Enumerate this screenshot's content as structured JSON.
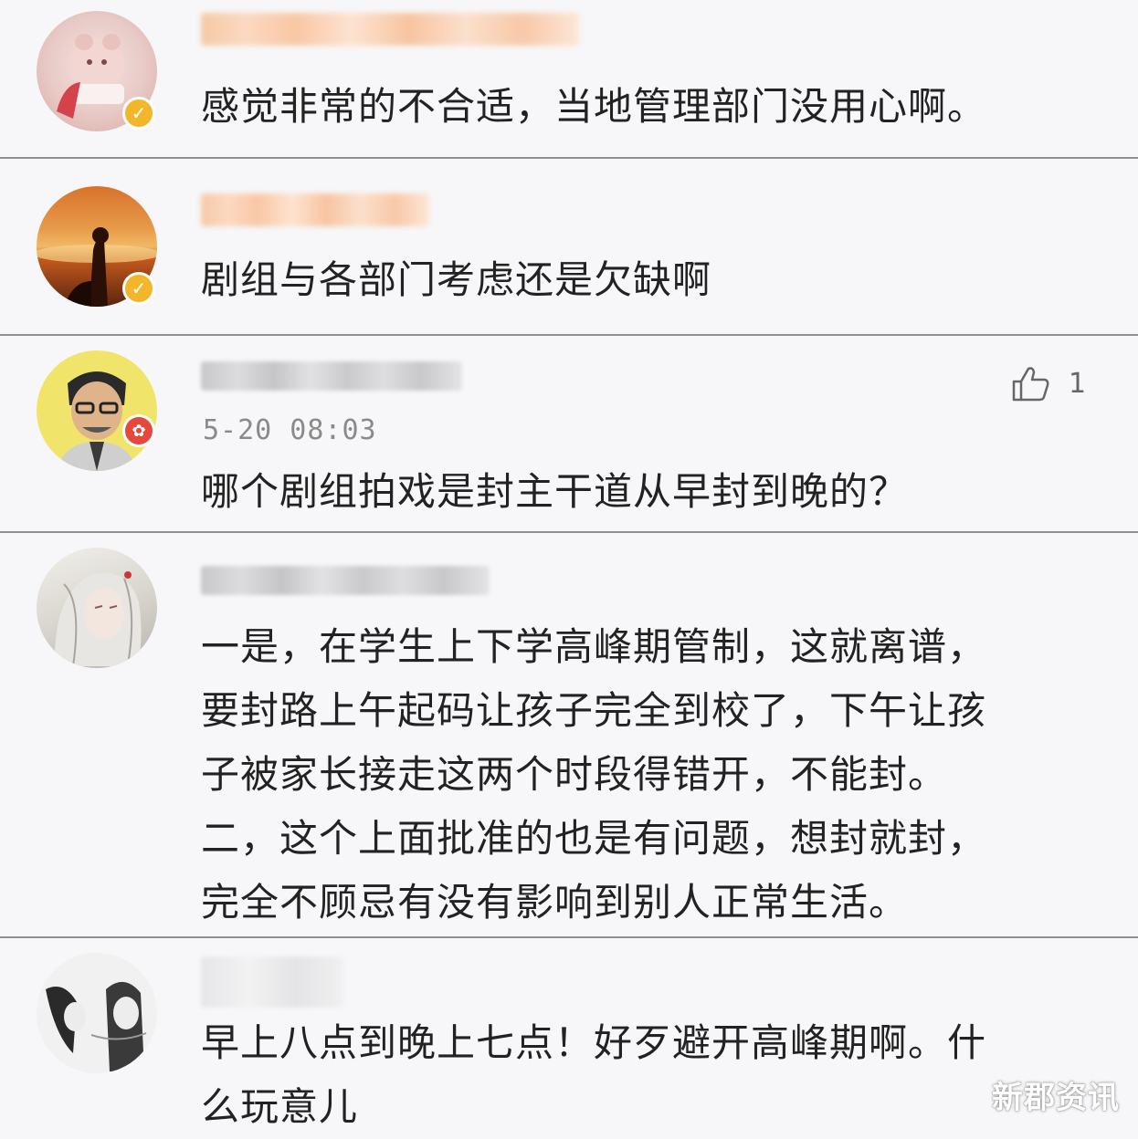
{
  "comments": [
    {
      "text": "感觉非常的不合适，当地管理部门没用心啊。"
    },
    {
      "text": "剧组与各部门考虑还是欠缺啊"
    },
    {
      "time": "5-20 08:03",
      "likes": "1",
      "text": "哪个剧组拍戏是封主干道从早封到晚的？"
    },
    {
      "lines": [
        "一是，在学生上下学高峰期管制，这就离谱，",
        "要封路上午起码让孩子完全到校了，下午让孩",
        "子被家长接走这两个时段得错开，不能封。",
        "二，这个上面批准的也是有问题，想封就封，",
        "完全不顾忌有没有影响到别人正常生活。"
      ]
    },
    {
      "lines": [
        "早上八点到晚上七点！好歹避开高峰期啊。什",
        "么玩意儿"
      ]
    }
  ],
  "watermark": "新郡资讯",
  "colors": {
    "vip_badge": "#f1b62a",
    "red_badge": "#e5493d",
    "text": "#222222",
    "meta": "#8a8a8a"
  }
}
